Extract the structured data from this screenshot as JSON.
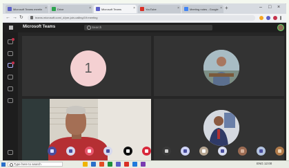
{
  "browser": {
    "tabs": [
      {
        "label": "Microsoft Teams meeting",
        "favicon_color": "#5b5fc7",
        "active": false
      },
      {
        "label": "Drive",
        "favicon_color": "#2da44e",
        "active": false
      },
      {
        "label": "Microsoft Teams",
        "favicon_color": "#5b5fc7",
        "active": true
      },
      {
        "label": "YouTube",
        "favicon_color": "#d93025",
        "active": false
      },
      {
        "label": "Meeting notes - Google Docs",
        "favicon_color": "#4285f4",
        "active": false
      }
    ],
    "new_tab_glyph": "+",
    "window_buttons": [
      "–",
      "□",
      "×"
    ],
    "nav_glyphs": {
      "back": "←",
      "forward": "→",
      "reload": "↻"
    },
    "url": "teams.microsoft.com/_#/pre-join-calling/19:meeting"
  },
  "teams": {
    "app_title": "Microsoft Teams",
    "search_placeholder": "Search"
  },
  "rail": {
    "icons": [
      "activity-icon",
      "chat-icon",
      "teams-icon",
      "calendar-icon",
      "calls-icon",
      "files-icon"
    ]
  },
  "meeting": {
    "tiles": [
      {
        "kind": "initial-avatar",
        "initial": "1",
        "avatar_color": "#f4d0d2"
      },
      {
        "kind": "photo-avatar"
      },
      {
        "kind": "video"
      },
      {
        "kind": "photo-avatar"
      }
    ]
  },
  "controls": [
    {
      "name": "camera-button",
      "bg": "#4a4e9e",
      "inner": "#dfe0ff"
    },
    {
      "name": "mic-button",
      "bg": "#d7d9ee",
      "inner": "#4a4e9e"
    },
    {
      "name": "share-button",
      "bg": "#e7576c",
      "inner": "#ffffff"
    },
    {
      "name": "more-actions-button",
      "bg": "#d7d9ee",
      "inner": "#4a4e9e"
    },
    {
      "name": "raise-hand-button",
      "bg": "#0f0f0f",
      "inner": "#ffffff"
    },
    {
      "name": "hang-up-button",
      "bg": "#d8283a",
      "inner": "#ffffff"
    },
    {
      "name": "chat-button",
      "bg": "#3a3a3a",
      "inner": "#cfcfcf"
    },
    {
      "name": "participants-button",
      "bg": "#cfd3f5",
      "inner": "#4a4e9e"
    },
    {
      "name": "reactions-button",
      "bg": "#b5a591",
      "inner": "#ffffff"
    },
    {
      "name": "device-settings-button",
      "bg": "#d8dcef",
      "inner": "#4a4e9e"
    },
    {
      "name": "user-avatar-1",
      "bg": "#9b6b53",
      "inner": "#d6b19b"
    },
    {
      "name": "user-avatar-2",
      "bg": "#b3c3df",
      "inner": "#4a4e9e"
    },
    {
      "name": "user-avatar-3",
      "bg": "#b07a4a",
      "inner": "#f0d7b6"
    },
    {
      "name": "user-avatar-4",
      "bg": "#6f8fb7",
      "inner": "#ffffff"
    }
  ],
  "taskbar": {
    "search_placeholder": "Type here to search",
    "apps": [
      "#f0b400",
      "#2a6fc9",
      "#e34c26",
      "#1b8f3a",
      "#5b5fc7",
      "#d93025",
      "#1f7adb",
      "#7a3bb0"
    ],
    "tray_text": "ENG 12:00"
  }
}
